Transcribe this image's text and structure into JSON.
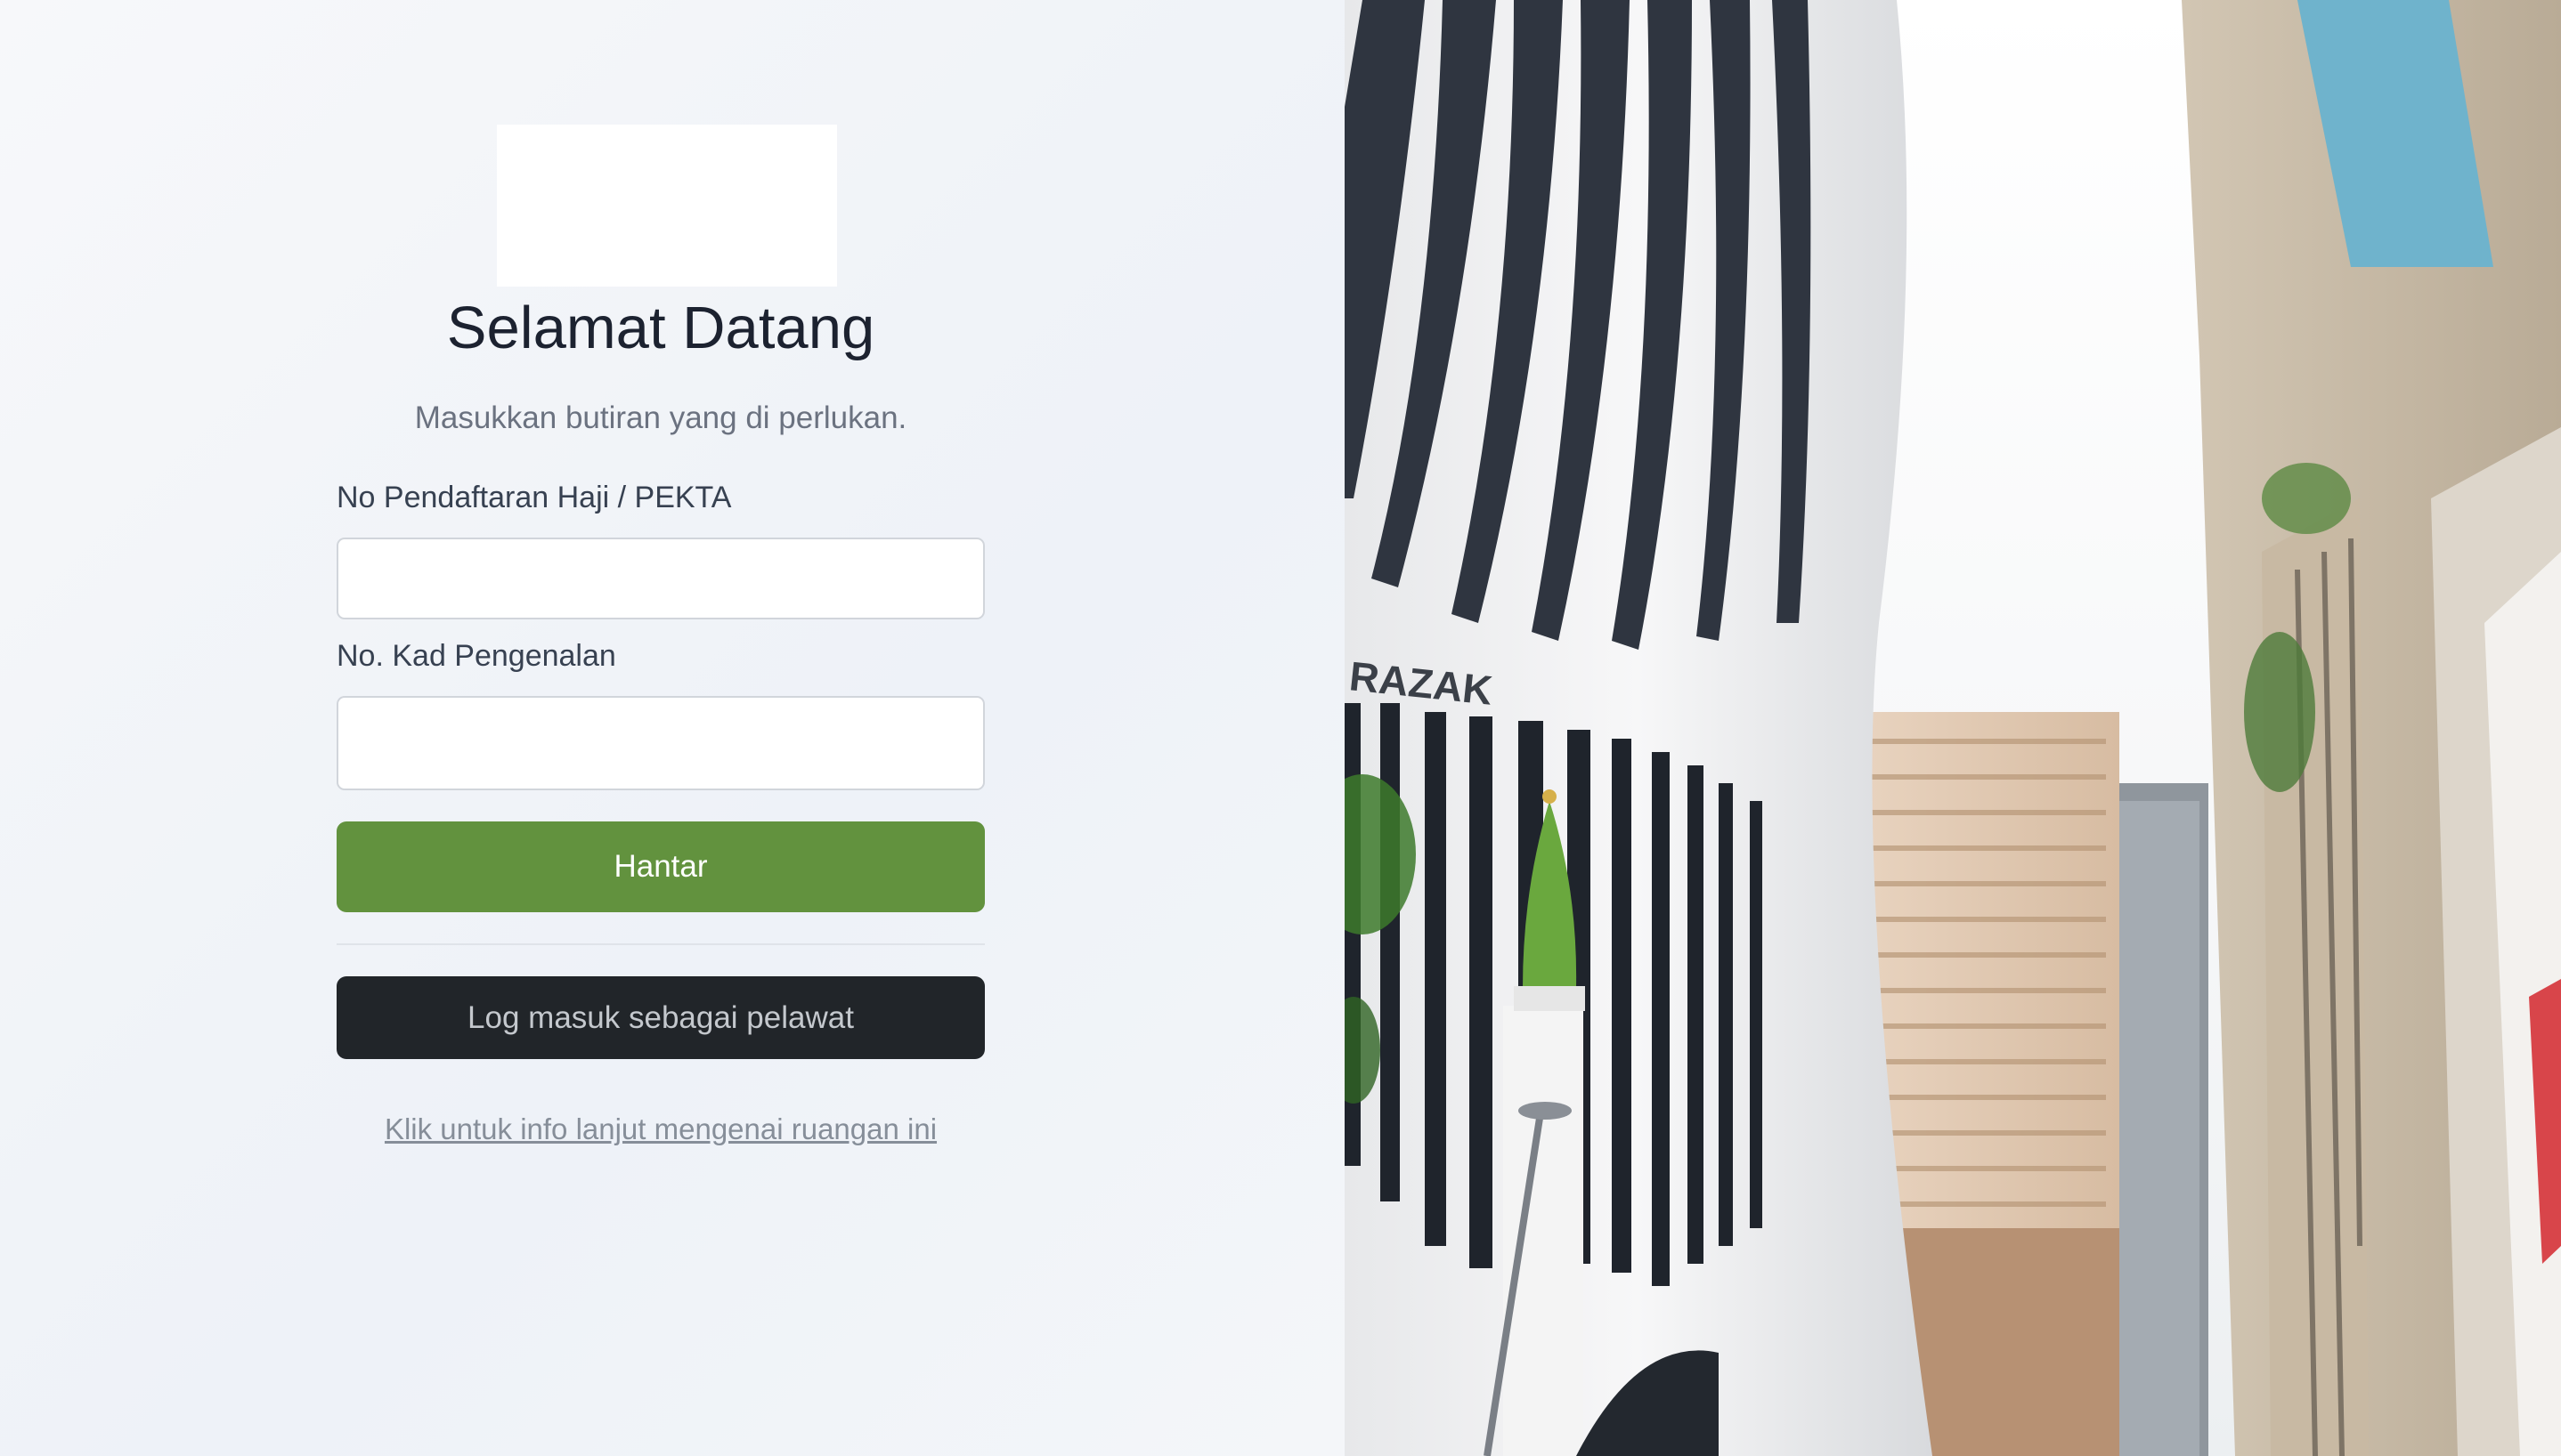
{
  "login": {
    "title": "Selamat Datang",
    "subtitle": "Masukkan butiran yang di perlukan.",
    "field_registration_label": "No Pendaftaran Haji / PEKTA",
    "field_registration_value": "",
    "field_ic_label": "No. Kad Pengenalan",
    "field_ic_value": "",
    "submit_label": "Hantar",
    "guest_label": "Log masuk sebagai pelawat",
    "info_link": "Klik untuk info lanjut mengenai ruangan ini"
  },
  "photo": {
    "sign_text": "RAZAK"
  },
  "colors": {
    "primary_green": "#62923e",
    "dark_button": "#212529"
  }
}
